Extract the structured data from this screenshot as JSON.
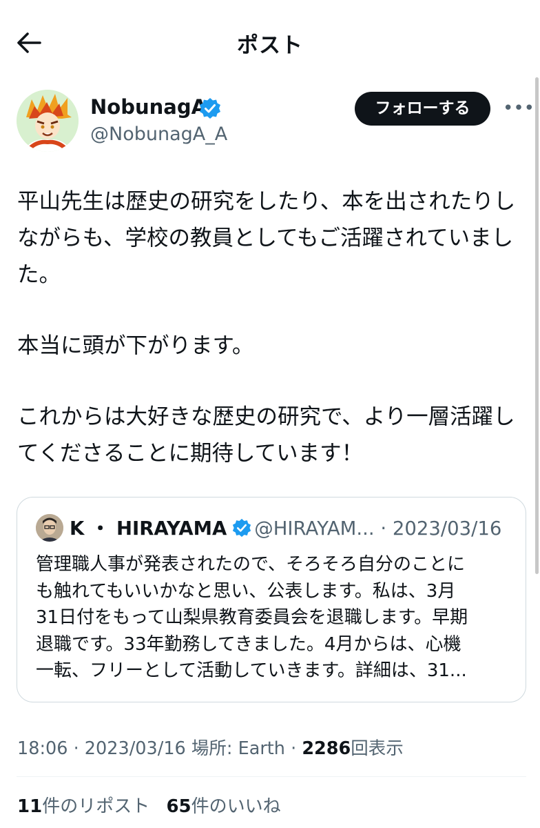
{
  "header": {
    "title": "ポスト"
  },
  "author": {
    "name": "NobunagA",
    "handle": "@NobunagA_A",
    "follow_label": "フォローする",
    "more_label": "•••"
  },
  "tweet": {
    "lines": [
      "平山先生は歴史の研究をしたり、本を出されたりし",
      "ながらも、学校の教員としてもご活躍されていまし",
      "た。",
      "",
      "本当に頭が下がります。",
      "",
      "これからは大好きな歴史の研究で、より一層活躍し",
      "てくださることに期待しています！"
    ]
  },
  "quote": {
    "name": "K ・ HIRAYAMA",
    "handle_date": "@HIRAYAM... · 2023/03/16",
    "lines": [
      "管理職人事が発表されたので、そろそろ自分のことに",
      "も触れてもいいかなと思い、公表します。私は、3月",
      "31日付をもって山梨県教育委員会を退職します。早期",
      "退職です。33年勤務してきました。4月からは、心機",
      "一転、フリーとして活動していきます。詳細は、31..."
    ]
  },
  "meta": {
    "time_date": "18:06 · 2023/03/16",
    "location": "場所: Earth",
    "separator": "·",
    "views_count": "2286",
    "views_label": "回表示"
  },
  "stats": {
    "reposts_count": "11",
    "reposts_label": "件のリポスト",
    "likes_count": "65",
    "likes_label": "件のいいね"
  },
  "colors": {
    "text": "#0f1419",
    "secondary": "#536471",
    "verified": "#1d9bf0",
    "border": "#cfd9de"
  }
}
